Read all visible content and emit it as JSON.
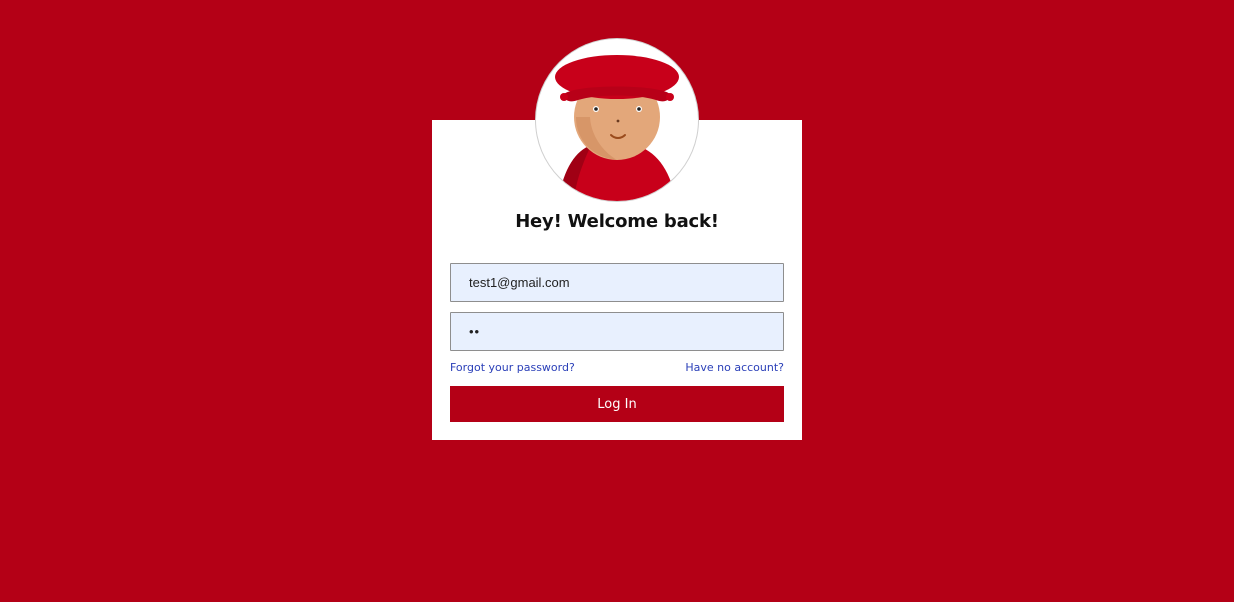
{
  "login": {
    "title": "Hey! Welcome back!",
    "email_value": "test1@gmail.com",
    "password_value": "••",
    "forgot_label": "Forgot your password?",
    "signup_label": "Have no account?",
    "login_label": "Log In"
  },
  "colors": {
    "background": "#b40016",
    "card": "#ffffff",
    "input_background": "#e8f0fe",
    "link": "#2a3fb8",
    "button": "#b40016"
  },
  "icons": {
    "avatar": "person-with-red-hat-avatar"
  }
}
